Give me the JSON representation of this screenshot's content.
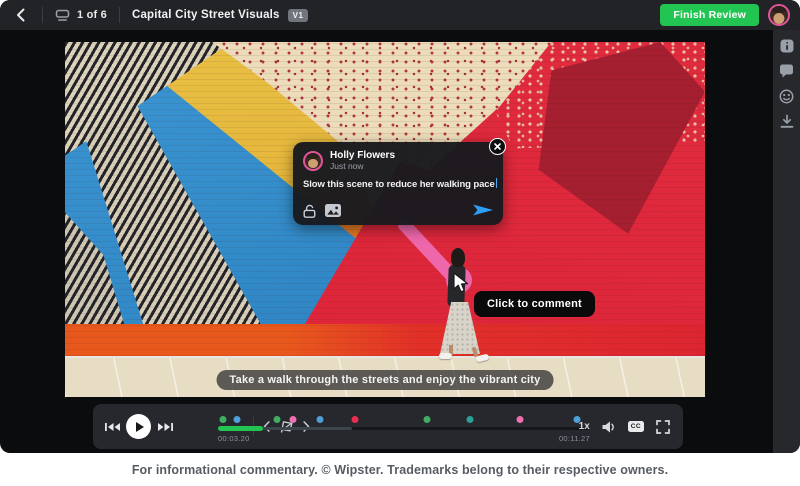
{
  "topbar": {
    "counter": "1 of 6",
    "title": "Capital City Street Visuals",
    "version_badge": "V1",
    "finish_button": "Finish Review"
  },
  "sidebar": {
    "icons": [
      "info",
      "comments",
      "reactions",
      "download"
    ]
  },
  "video": {
    "caption": "Take a walk through the streets and enjoy the vibrant city",
    "tooltip": "Click to comment",
    "comment_card": {
      "author": "Holly Flowers",
      "timestamp": "Just now",
      "draft_text": "Slow this scene to reduce her walking pace"
    }
  },
  "playbar": {
    "current_time": "00:03.20",
    "total_time": "00:11.27",
    "speed": "1x",
    "cc_label": "CC",
    "progress_fraction": 0.12,
    "buffer_fraction": 0.36,
    "markers": [
      {
        "pos": 0.013,
        "color": "#3fae63"
      },
      {
        "pos": 0.051,
        "color": "#4f9fd8"
      },
      {
        "pos": 0.159,
        "color": "#3fae63"
      },
      {
        "pos": 0.202,
        "color": "#ef6fb0"
      },
      {
        "pos": 0.274,
        "color": "#4f9fd8"
      },
      {
        "pos": 0.368,
        "color": "#ea2e50"
      },
      {
        "pos": 0.562,
        "color": "#3fae63"
      },
      {
        "pos": 0.677,
        "color": "#2f9e98"
      },
      {
        "pos": 0.812,
        "color": "#ef6fb0"
      },
      {
        "pos": 0.965,
        "color": "#4f9fd8"
      }
    ]
  },
  "footer": {
    "disclaimer": "For informational commentary. © Wipster. Trademarks belong to their respective owners."
  },
  "colors": {
    "accent_green": "#23c552",
    "send_blue": "#2e9df5",
    "avatar_ring_pink": "#e0559a"
  }
}
